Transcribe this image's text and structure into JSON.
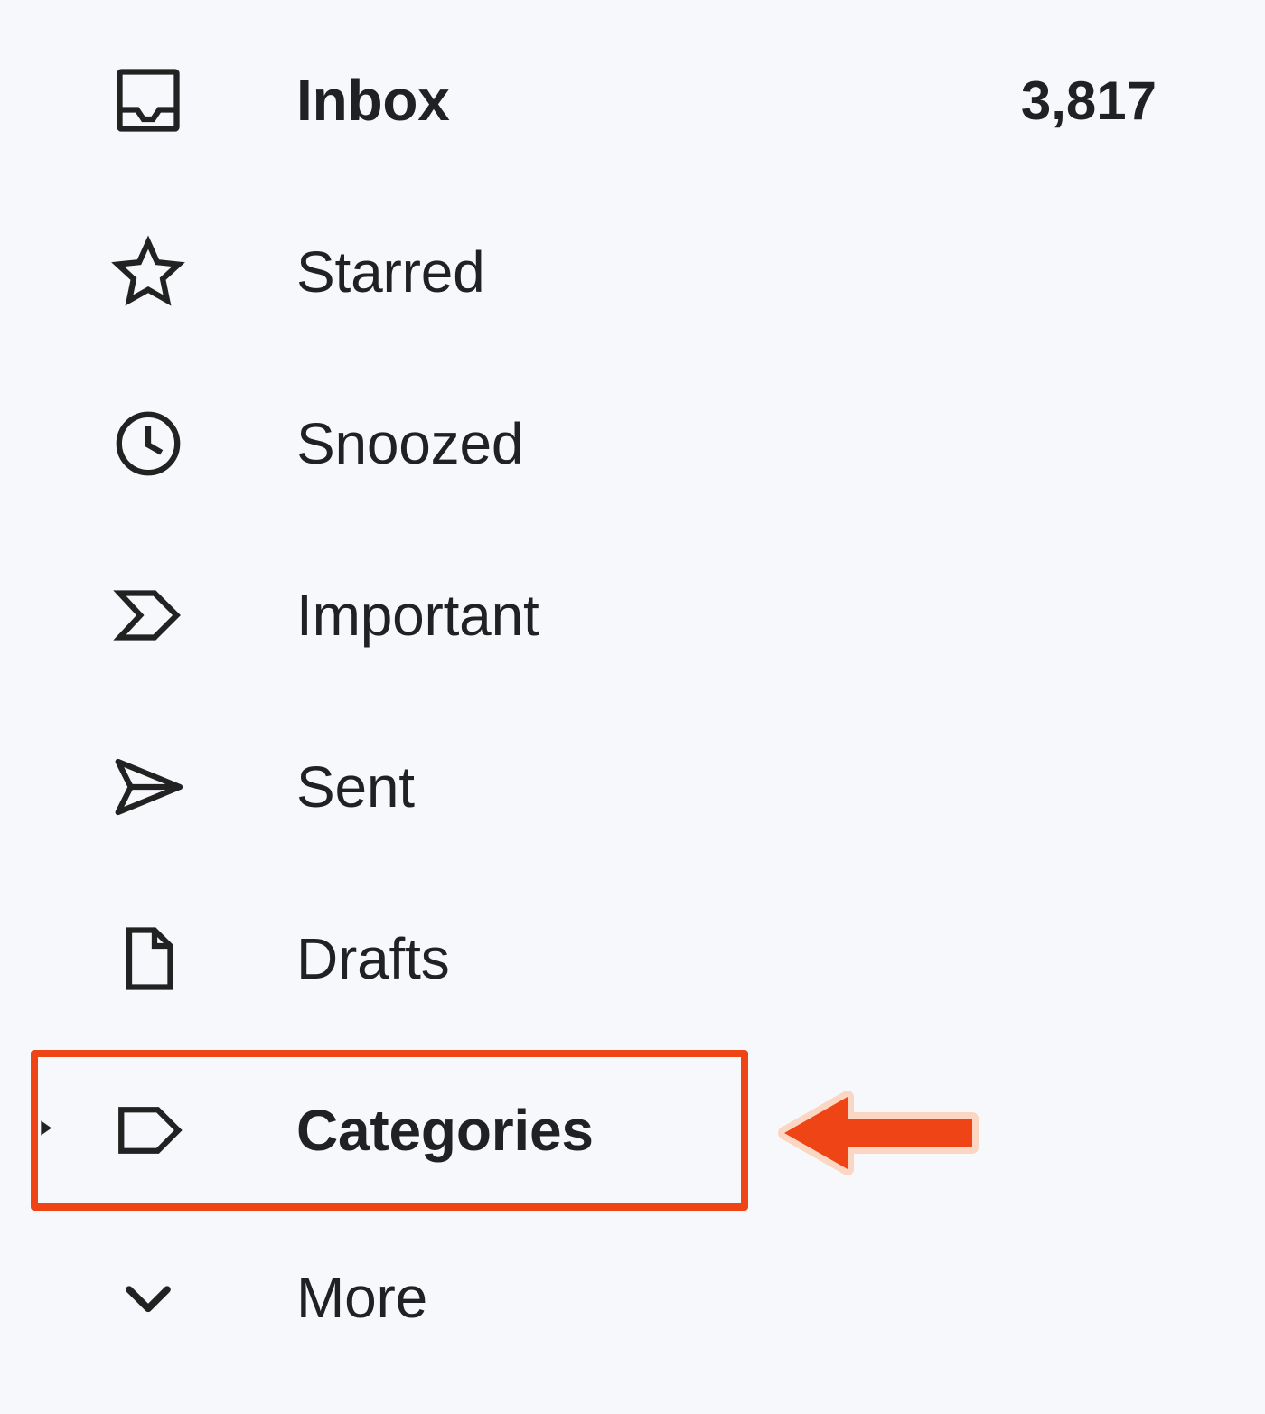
{
  "sidebar": {
    "items": [
      {
        "label": "Inbox",
        "count": "3,817",
        "bold": true
      },
      {
        "label": "Starred"
      },
      {
        "label": "Snoozed"
      },
      {
        "label": "Important"
      },
      {
        "label": "Sent"
      },
      {
        "label": "Drafts"
      },
      {
        "label": "Categories",
        "bold": true,
        "expandable": true
      },
      {
        "label": "More"
      }
    ]
  },
  "annotation": {
    "highlight_target": "categories",
    "arrow": true
  }
}
